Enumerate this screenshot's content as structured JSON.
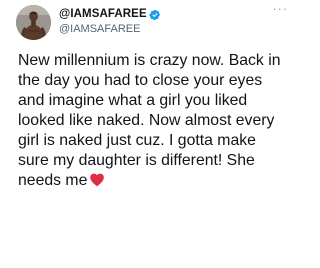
{
  "tweet": {
    "display_name": "@IAMSAFAREE",
    "handle": "@IAMSAFAREE",
    "verified": true,
    "accent_color": "#1d9bf0",
    "text": "New millennium is crazy now. Back in the day you had to close your eyes and imagine what a girl you liked looked like naked. Now almost every girl is naked just cuz. I gotta make sure my daughter is different! She needs me",
    "emoji": "red-heart",
    "more_menu_glyph": "···"
  }
}
